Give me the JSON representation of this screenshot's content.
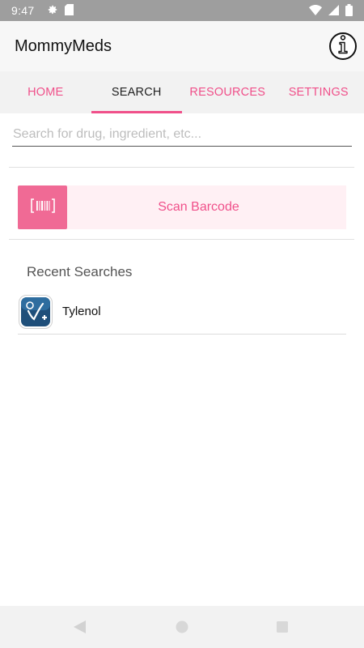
{
  "status_bar": {
    "time": "9:47",
    "icons_left": [
      "settings-icon",
      "sim-card-icon"
    ],
    "icons_right": [
      "wifi-icon",
      "signal-icon",
      "battery-icon"
    ]
  },
  "app_bar": {
    "title": "MommyMeds",
    "info_icon": "info-icon"
  },
  "tabs": [
    {
      "label": "HOME",
      "active": false
    },
    {
      "label": "SEARCH",
      "active": true
    },
    {
      "label": "RESOURCES",
      "active": false
    },
    {
      "label": "SETTINGS",
      "active": false
    }
  ],
  "search": {
    "placeholder": "Search for drug, ingredient, etc...",
    "value": ""
  },
  "scan": {
    "label": "Scan Barcode",
    "icon": "barcode-icon"
  },
  "recent": {
    "title": "Recent Searches",
    "items": [
      {
        "label": "Tylenol",
        "icon": "app-logo-icon"
      }
    ]
  },
  "nav_bar": {
    "icons": [
      "back-icon",
      "home-icon",
      "recents-icon"
    ]
  },
  "colors": {
    "accent": "#f0508a",
    "scan_bg": "#fff0f4",
    "scan_icon_bg": "#f06a95",
    "status_bar": "#9e9e9e"
  }
}
